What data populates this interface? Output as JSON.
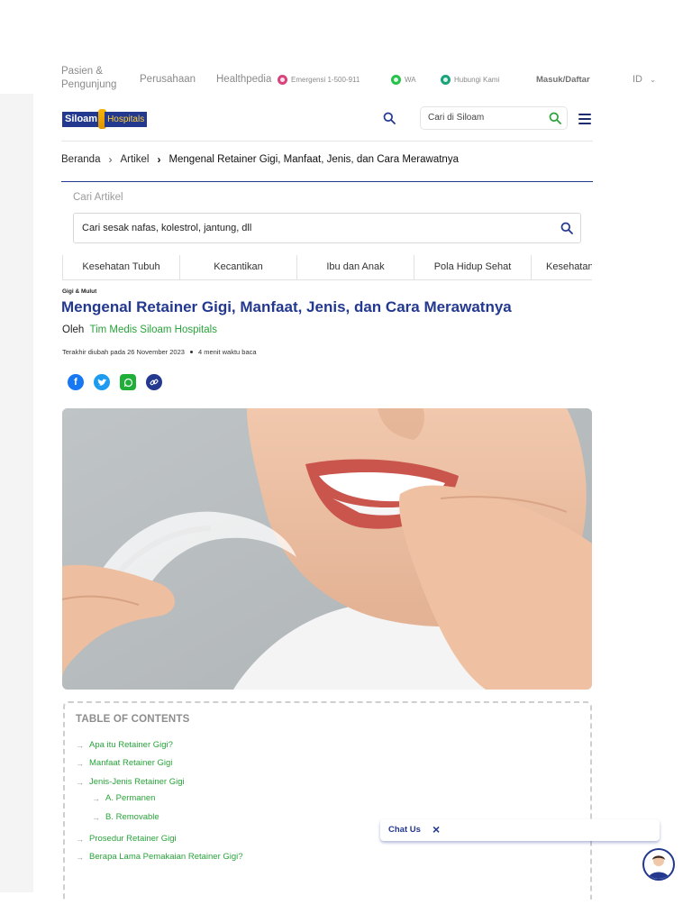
{
  "topbar": {
    "pasien": "Pasien & Pengunjung",
    "perusahaan": "Perusahaan",
    "healthpedia": "Healthpedia",
    "emergensi": "Emergensi 1-500-911",
    "wa": "WA",
    "hubungi": "Hubungi Kami",
    "masuk": "Masuk/Daftar",
    "lang": "ID"
  },
  "header": {
    "logo_part1": "Siloam",
    "logo_part2": "Hospitals",
    "search_placeholder": "Cari di Siloam"
  },
  "breadcrumb": {
    "home": "Beranda",
    "section": "Artikel",
    "current": "Mengenal Retainer Gigi, Manfaat, Jenis, dan Cara Merawatnya"
  },
  "article_search": {
    "label": "Cari Artikel",
    "placeholder": "Cari sesak nafas, kolestrol, jantung, dll"
  },
  "categories": [
    "Kesehatan Tubuh",
    "Kecantikan",
    "Ibu dan Anak",
    "Pola Hidup Sehat",
    "Kesehatan"
  ],
  "article": {
    "tag": "Gigi & Mulut",
    "title": "Mengenal Retainer Gigi, Manfaat, Jenis, dan Cara Merawatnya",
    "by": "Oleh",
    "author": "Tim Medis Siloam Hospitals",
    "updated": "Terakhir diubah pada 26 November 2023",
    "read_time": "4 menit waktu baca"
  },
  "share_icons": [
    "facebook-icon",
    "twitter-icon",
    "whatsapp-icon",
    "link-icon"
  ],
  "toc": {
    "title": "TABLE OF CONTENTS",
    "items": [
      {
        "label": "Apa itu Retainer Gigi?"
      },
      {
        "label": "Manfaat Retainer Gigi"
      },
      {
        "label": "Jenis-Jenis Retainer Gigi"
      },
      {
        "label": "A. Permanen"
      },
      {
        "label": "B. Removable"
      },
      {
        "label": "Prosedur Retainer Gigi"
      },
      {
        "label": "Berapa Lama Pemakaian Retainer Gigi?"
      }
    ]
  },
  "chat": {
    "label": "Chat Us"
  },
  "colors": {
    "brand_navy": "#23388f",
    "brand_green": "#29a33a",
    "logo_gold": "#f7b500"
  }
}
